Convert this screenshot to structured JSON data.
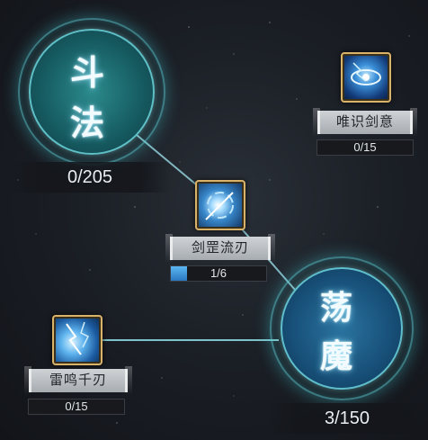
{
  "big_nodes": [
    {
      "id": "doufa",
      "chars": [
        "斗",
        "法"
      ],
      "count": "0/205"
    },
    {
      "id": "dangmo",
      "chars": [
        "荡",
        "魔"
      ],
      "count": "3/150"
    }
  ],
  "skills": [
    {
      "id": "weishi",
      "label": "唯识剑意",
      "progress_text": "0/15",
      "progress_fraction": 0,
      "icon": "eye-lightning-icon"
    },
    {
      "id": "jianzhao",
      "label": "剑罡流刃",
      "progress_text": "1/6",
      "progress_fraction": 0.1667,
      "icon": "sword-gale-icon"
    },
    {
      "id": "leiming",
      "label": "雷鸣千刃",
      "progress_text": "0/15",
      "progress_fraction": 0,
      "icon": "thunder-blades-icon"
    }
  ],
  "colors": {
    "glow": "#5ac8d2",
    "progress_fill": "#3b95d8",
    "icon_frame": "#d9b36a"
  }
}
